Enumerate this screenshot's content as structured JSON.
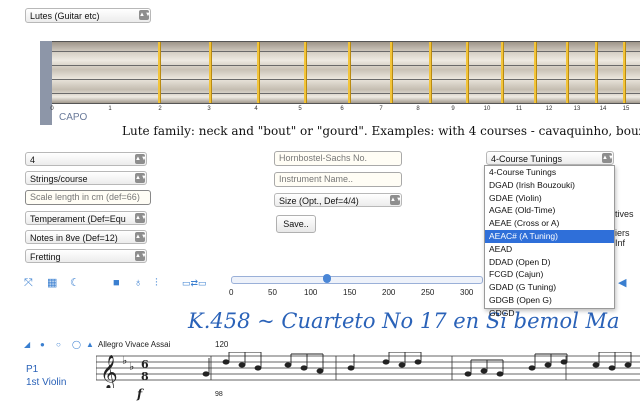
{
  "instrument_family_select": {
    "value": "Lutes (Guitar etc)"
  },
  "neck": {
    "capo_label": "CAPO",
    "fret_numbers": [
      "0",
      "1",
      "2",
      "3",
      "4",
      "5",
      "6",
      "7",
      "8",
      "9",
      "10",
      "11",
      "12",
      "13",
      "14",
      "15"
    ]
  },
  "description": "Lute family: neck and \"bout\" or \"gourd\". Examples: with 4 courses - cavaquinho, bouzouki",
  "left_controls": {
    "courses_select": "4",
    "strings_course_select": "Strings/course",
    "scale_length_placeholder": "Scale length in cm (def=66)",
    "temperament_select": "Temperament (Def=Equ",
    "notes_select": "Notes in 8ve (Def=12)",
    "fretting_select": "Fretting"
  },
  "middle_controls": {
    "hornbostel_placeholder": "Hornbostel-Sachs No.",
    "instrument_name_placeholder": "Instrument Name..",
    "size_select": "Size (Opt., Def=4/4)",
    "save_label": "Save.."
  },
  "tunings": {
    "select_value": "4-Course Tunings",
    "options": [
      "4-Course Tunings",
      "DGAD (Irish Bouzouki)",
      "GDAE (Violin)",
      "AGAE (Old-Time)",
      "AEAE (Cross or A)",
      "AEAC# (A Tuning)",
      "AEAD",
      "DDAD (Open D)",
      "FCGD (Cajun)",
      "GDAD (G Tuning)",
      "GDGB (Open G)",
      "GDGD"
    ],
    "highlighted_index": 5
  },
  "partial_right_text": {
    "line1": "tives",
    "line2": "iers Inf"
  },
  "toolbar_icons": [
    "expand-icon",
    "grid-icon",
    "moon-icon",
    "video-icon",
    "mic-icon",
    "mixer-icon",
    "swap-icon"
  ],
  "slider": {
    "ticks": [
      "0",
      "50",
      "100",
      "150",
      "200",
      "250",
      "300"
    ],
    "min": 0,
    "max": 300,
    "value": 120
  },
  "score": {
    "title": "K.458 ~ Cuarteto No 17 en Si bemol Ma",
    "tempo_text": "Allegro Vivace Assai",
    "measure_120": "120",
    "measure_98": "98",
    "part_label": "P1",
    "part_name": "1st Violin",
    "dynamic": "f"
  }
}
